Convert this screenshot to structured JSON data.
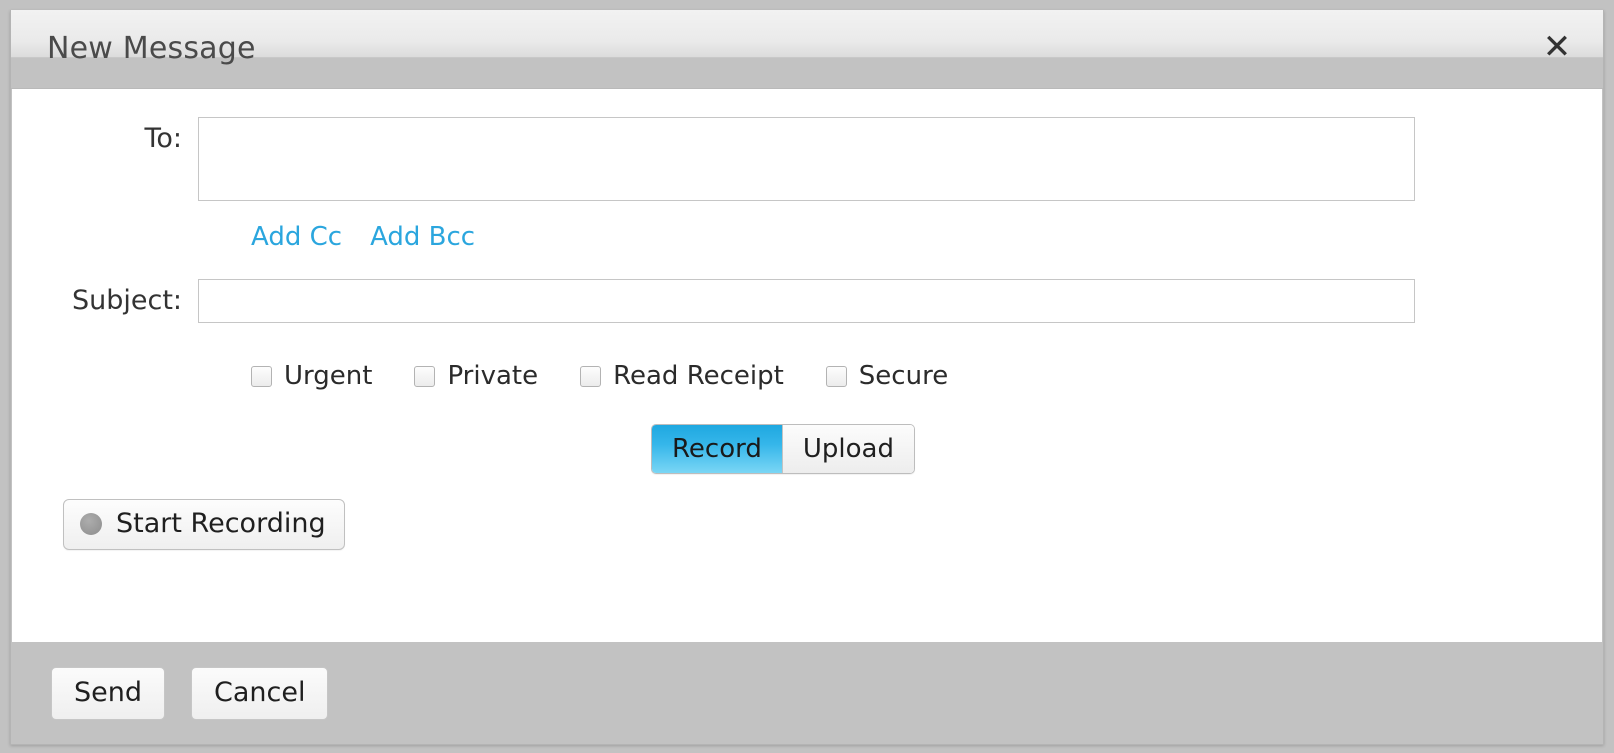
{
  "dialog": {
    "title": "New Message",
    "close_icon": "close-icon"
  },
  "form": {
    "to": {
      "label": "To:",
      "value": "",
      "placeholder": ""
    },
    "links": [
      {
        "label": "Add Cc"
      },
      {
        "label": "Add Bcc"
      }
    ],
    "subject": {
      "label": "Subject:",
      "value": "",
      "placeholder": ""
    },
    "options": [
      {
        "label": "Urgent",
        "checked": false
      },
      {
        "label": "Private",
        "checked": false
      },
      {
        "label": "Read Receipt",
        "checked": false
      },
      {
        "label": "Secure",
        "checked": false
      }
    ],
    "attachment_mode": {
      "selected": "Record",
      "tabs": [
        {
          "label": "Record",
          "active": true
        },
        {
          "label": "Upload",
          "active": false
        }
      ]
    },
    "record": {
      "button_label": "Start Recording",
      "dot_icon": "record-dot-icon"
    }
  },
  "footer": {
    "send_label": "Send",
    "cancel_label": "Cancel"
  },
  "colors": {
    "accent": "#2ba6de",
    "active_tab_top": "#1fa8e0",
    "active_tab_bottom": "#7ad6f5",
    "chrome_gray": "#c2c2c2",
    "body_white": "#ffffff"
  }
}
